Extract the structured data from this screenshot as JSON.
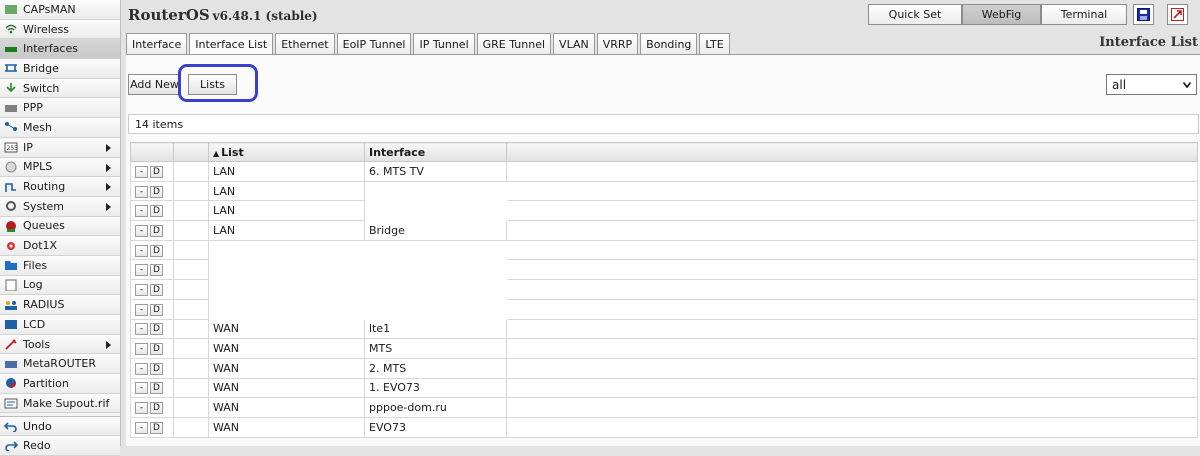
{
  "sidebar": {
    "items": [
      {
        "label": "CAPsMAN",
        "icon": "capsman-icon"
      },
      {
        "label": "Wireless",
        "icon": "wireless-icon"
      },
      {
        "label": "Interfaces",
        "icon": "interfaces-icon"
      },
      {
        "label": "Bridge",
        "icon": "bridge-icon"
      },
      {
        "label": "Switch",
        "icon": "switch-icon"
      },
      {
        "label": "PPP",
        "icon": "ppp-icon"
      },
      {
        "label": "Mesh",
        "icon": "mesh-icon"
      },
      {
        "label": "IP",
        "icon": "ip-icon"
      },
      {
        "label": "MPLS",
        "icon": "mpls-icon"
      },
      {
        "label": "Routing",
        "icon": "routing-icon"
      },
      {
        "label": "System",
        "icon": "system-icon"
      },
      {
        "label": "Queues",
        "icon": "queues-icon"
      },
      {
        "label": "Dot1X",
        "icon": "dot1x-icon"
      },
      {
        "label": "Files",
        "icon": "files-icon"
      },
      {
        "label": "Log",
        "icon": "log-icon"
      },
      {
        "label": "RADIUS",
        "icon": "radius-icon"
      },
      {
        "label": "LCD",
        "icon": "lcd-icon"
      },
      {
        "label": "Tools",
        "icon": "tools-icon"
      },
      {
        "label": "MetaROUTER",
        "icon": "metarouter-icon"
      },
      {
        "label": "Partition",
        "icon": "partition-icon"
      },
      {
        "label": "Make Supout.rif",
        "icon": "supout-icon"
      },
      {
        "label": "Undo",
        "icon": "undo-icon"
      },
      {
        "label": "Redo",
        "icon": "redo-icon"
      }
    ]
  },
  "header": {
    "title": "RouterOS",
    "version": "v6.48.1 (stable)",
    "modes": [
      "Quick Set",
      "WebFig",
      "Terminal"
    ]
  },
  "tabs": [
    "Interface",
    "Interface List",
    "Ethernet",
    "EoIP Tunnel",
    "IP Tunnel",
    "GRE Tunnel",
    "VLAN",
    "VRRP",
    "Bonding",
    "LTE"
  ],
  "section_title": "Interface List",
  "toolbar": {
    "add_new": "Add New",
    "lists": "Lists",
    "filter_value": "all"
  },
  "count_text": "14 items",
  "table": {
    "columns": [
      "",
      "",
      "List",
      "Interface",
      ""
    ],
    "rows": [
      {
        "list": "LAN",
        "interface": "6. MTS TV"
      },
      {
        "list": "LAN",
        "interface": ""
      },
      {
        "list": "LAN",
        "interface": ""
      },
      {
        "list": "LAN",
        "interface": "Bridge"
      },
      {
        "list": "",
        "interface": ""
      },
      {
        "list": "",
        "interface": ""
      },
      {
        "list": "",
        "interface": ""
      },
      {
        "list": "",
        "interface": ""
      },
      {
        "list": "WAN",
        "interface": "lte1"
      },
      {
        "list": "WAN",
        "interface": "MTS"
      },
      {
        "list": "WAN",
        "interface": "2. MTS"
      },
      {
        "list": "WAN",
        "interface": "1. EVO73"
      },
      {
        "list": "WAN",
        "interface": "pppoe-dom.ru"
      },
      {
        "list": "WAN",
        "interface": "EVO73"
      }
    ],
    "row_buttons": [
      "-",
      "D"
    ]
  },
  "colors": {
    "highlight": "#3b3fd0",
    "sidebar_bg": "#f3f3f3"
  }
}
